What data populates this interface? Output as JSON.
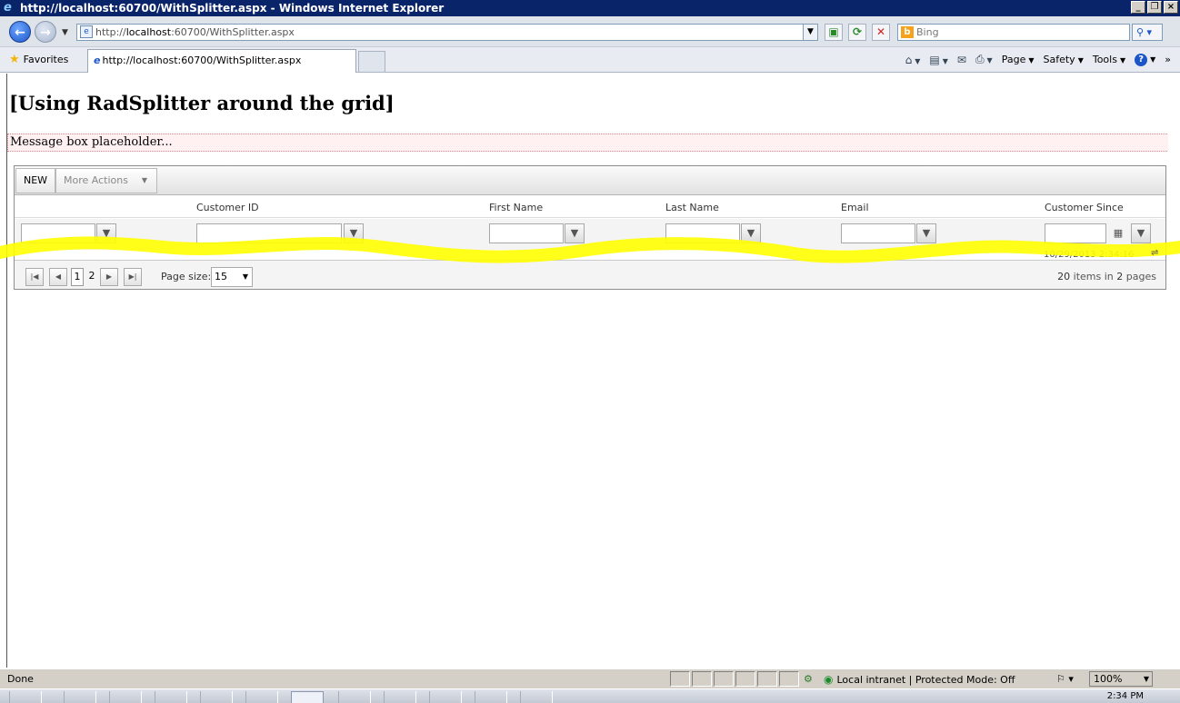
{
  "window": {
    "title": "http://localhost:60700/WithSplitter.aspx - Windows Internet Explorer"
  },
  "address": {
    "prefix": "http://",
    "host": "localhost",
    "rest": ":60700/WithSplitter.aspx"
  },
  "search": {
    "placeholder": "Bing"
  },
  "favorites": {
    "label": "Favorites"
  },
  "tab": {
    "label": "http://localhost:60700/WithSplitter.aspx"
  },
  "commandbar": {
    "page": "Page",
    "safety": "Safety",
    "tools": "Tools"
  },
  "page": {
    "title": "[Using RadSplitter around the grid]",
    "message": "Message box placeholder..."
  },
  "grid": {
    "new_label": "NEW",
    "more_actions_label": "More Actions",
    "columns": [
      "Customer ID",
      "First Name",
      "Last Name",
      "Email",
      "Customer Since"
    ],
    "partial_row_value": "10/29/2013 2:34:16",
    "pager": {
      "current_page": "1",
      "other_page": "2",
      "page_size_label": "Page size:",
      "page_size_value": "15",
      "items_count": "20",
      "items_text": "items in",
      "pages_count": "2",
      "pages_text": "pages"
    }
  },
  "statusbar": {
    "status": "Done",
    "zone": "Local intranet | Protected Mode: Off",
    "zoom": "100%"
  },
  "taskbar": {
    "time": "2:34 PM"
  },
  "colors": {
    "titlebar": "#0a246a",
    "highlighter": "#ffff00",
    "message_bg": "#fff1f1"
  }
}
